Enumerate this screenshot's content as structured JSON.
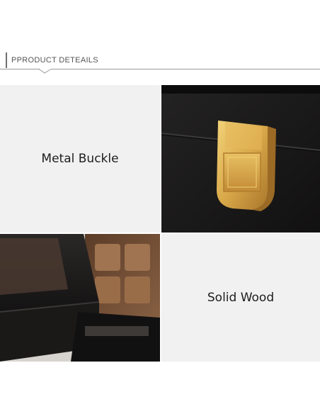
{
  "header": {
    "title": "PPRODUCT DETEAILS"
  },
  "features": [
    {
      "label": "Metal Buckle"
    },
    {
      "label": "Solid Wood"
    }
  ],
  "photos": [
    {
      "icon": "metal-buckle-photo"
    },
    {
      "icon": "wooden-watch-box-photo"
    }
  ],
  "colors": {
    "panel_background": "#f1f1f1",
    "box_black": "#1b1a1a",
    "buckle_gold": "#d9a94a",
    "wood_brown": "#7a5637"
  }
}
